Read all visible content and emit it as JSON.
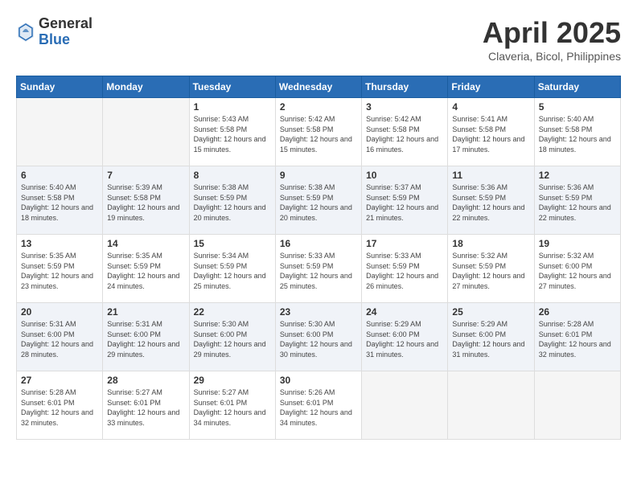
{
  "header": {
    "logo_general": "General",
    "logo_blue": "Blue",
    "month_year": "April 2025",
    "location": "Claveria, Bicol, Philippines"
  },
  "weekdays": [
    "Sunday",
    "Monday",
    "Tuesday",
    "Wednesday",
    "Thursday",
    "Friday",
    "Saturday"
  ],
  "days": [
    {
      "num": "",
      "sunrise": "",
      "sunset": "",
      "daylight": "",
      "empty": true
    },
    {
      "num": "",
      "sunrise": "",
      "sunset": "",
      "daylight": "",
      "empty": true
    },
    {
      "num": "1",
      "sunrise": "Sunrise: 5:43 AM",
      "sunset": "Sunset: 5:58 PM",
      "daylight": "Daylight: 12 hours and 15 minutes."
    },
    {
      "num": "2",
      "sunrise": "Sunrise: 5:42 AM",
      "sunset": "Sunset: 5:58 PM",
      "daylight": "Daylight: 12 hours and 15 minutes."
    },
    {
      "num": "3",
      "sunrise": "Sunrise: 5:42 AM",
      "sunset": "Sunset: 5:58 PM",
      "daylight": "Daylight: 12 hours and 16 minutes."
    },
    {
      "num": "4",
      "sunrise": "Sunrise: 5:41 AM",
      "sunset": "Sunset: 5:58 PM",
      "daylight": "Daylight: 12 hours and 17 minutes."
    },
    {
      "num": "5",
      "sunrise": "Sunrise: 5:40 AM",
      "sunset": "Sunset: 5:58 PM",
      "daylight": "Daylight: 12 hours and 18 minutes."
    },
    {
      "num": "6",
      "sunrise": "Sunrise: 5:40 AM",
      "sunset": "Sunset: 5:58 PM",
      "daylight": "Daylight: 12 hours and 18 minutes."
    },
    {
      "num": "7",
      "sunrise": "Sunrise: 5:39 AM",
      "sunset": "Sunset: 5:58 PM",
      "daylight": "Daylight: 12 hours and 19 minutes."
    },
    {
      "num": "8",
      "sunrise": "Sunrise: 5:38 AM",
      "sunset": "Sunset: 5:59 PM",
      "daylight": "Daylight: 12 hours and 20 minutes."
    },
    {
      "num": "9",
      "sunrise": "Sunrise: 5:38 AM",
      "sunset": "Sunset: 5:59 PM",
      "daylight": "Daylight: 12 hours and 20 minutes."
    },
    {
      "num": "10",
      "sunrise": "Sunrise: 5:37 AM",
      "sunset": "Sunset: 5:59 PM",
      "daylight": "Daylight: 12 hours and 21 minutes."
    },
    {
      "num": "11",
      "sunrise": "Sunrise: 5:36 AM",
      "sunset": "Sunset: 5:59 PM",
      "daylight": "Daylight: 12 hours and 22 minutes."
    },
    {
      "num": "12",
      "sunrise": "Sunrise: 5:36 AM",
      "sunset": "Sunset: 5:59 PM",
      "daylight": "Daylight: 12 hours and 22 minutes."
    },
    {
      "num": "13",
      "sunrise": "Sunrise: 5:35 AM",
      "sunset": "Sunset: 5:59 PM",
      "daylight": "Daylight: 12 hours and 23 minutes."
    },
    {
      "num": "14",
      "sunrise": "Sunrise: 5:35 AM",
      "sunset": "Sunset: 5:59 PM",
      "daylight": "Daylight: 12 hours and 24 minutes."
    },
    {
      "num": "15",
      "sunrise": "Sunrise: 5:34 AM",
      "sunset": "Sunset: 5:59 PM",
      "daylight": "Daylight: 12 hours and 25 minutes."
    },
    {
      "num": "16",
      "sunrise": "Sunrise: 5:33 AM",
      "sunset": "Sunset: 5:59 PM",
      "daylight": "Daylight: 12 hours and 25 minutes."
    },
    {
      "num": "17",
      "sunrise": "Sunrise: 5:33 AM",
      "sunset": "Sunset: 5:59 PM",
      "daylight": "Daylight: 12 hours and 26 minutes."
    },
    {
      "num": "18",
      "sunrise": "Sunrise: 5:32 AM",
      "sunset": "Sunset: 5:59 PM",
      "daylight": "Daylight: 12 hours and 27 minutes."
    },
    {
      "num": "19",
      "sunrise": "Sunrise: 5:32 AM",
      "sunset": "Sunset: 6:00 PM",
      "daylight": "Daylight: 12 hours and 27 minutes."
    },
    {
      "num": "20",
      "sunrise": "Sunrise: 5:31 AM",
      "sunset": "Sunset: 6:00 PM",
      "daylight": "Daylight: 12 hours and 28 minutes."
    },
    {
      "num": "21",
      "sunrise": "Sunrise: 5:31 AM",
      "sunset": "Sunset: 6:00 PM",
      "daylight": "Daylight: 12 hours and 29 minutes."
    },
    {
      "num": "22",
      "sunrise": "Sunrise: 5:30 AM",
      "sunset": "Sunset: 6:00 PM",
      "daylight": "Daylight: 12 hours and 29 minutes."
    },
    {
      "num": "23",
      "sunrise": "Sunrise: 5:30 AM",
      "sunset": "Sunset: 6:00 PM",
      "daylight": "Daylight: 12 hours and 30 minutes."
    },
    {
      "num": "24",
      "sunrise": "Sunrise: 5:29 AM",
      "sunset": "Sunset: 6:00 PM",
      "daylight": "Daylight: 12 hours and 31 minutes."
    },
    {
      "num": "25",
      "sunrise": "Sunrise: 5:29 AM",
      "sunset": "Sunset: 6:00 PM",
      "daylight": "Daylight: 12 hours and 31 minutes."
    },
    {
      "num": "26",
      "sunrise": "Sunrise: 5:28 AM",
      "sunset": "Sunset: 6:01 PM",
      "daylight": "Daylight: 12 hours and 32 minutes."
    },
    {
      "num": "27",
      "sunrise": "Sunrise: 5:28 AM",
      "sunset": "Sunset: 6:01 PM",
      "daylight": "Daylight: 12 hours and 32 minutes."
    },
    {
      "num": "28",
      "sunrise": "Sunrise: 5:27 AM",
      "sunset": "Sunset: 6:01 PM",
      "daylight": "Daylight: 12 hours and 33 minutes."
    },
    {
      "num": "29",
      "sunrise": "Sunrise: 5:27 AM",
      "sunset": "Sunset: 6:01 PM",
      "daylight": "Daylight: 12 hours and 34 minutes."
    },
    {
      "num": "30",
      "sunrise": "Sunrise: 5:26 AM",
      "sunset": "Sunset: 6:01 PM",
      "daylight": "Daylight: 12 hours and 34 minutes."
    },
    {
      "num": "",
      "sunrise": "",
      "sunset": "",
      "daylight": "",
      "empty": true
    },
    {
      "num": "",
      "sunrise": "",
      "sunset": "",
      "daylight": "",
      "empty": true
    },
    {
      "num": "",
      "sunrise": "",
      "sunset": "",
      "daylight": "",
      "empty": true
    }
  ]
}
